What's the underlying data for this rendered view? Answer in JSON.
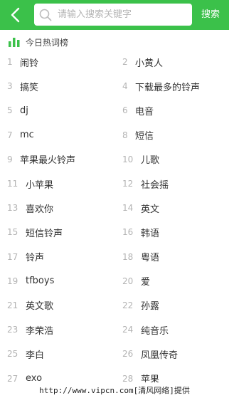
{
  "colors": {
    "accent": "#3bc14a",
    "rank_number": "#b3b3b3"
  },
  "header": {
    "back_icon": "chevron-left-icon",
    "search_placeholder": "请输入搜索关键字",
    "search_button": "搜索"
  },
  "hot": {
    "title": "今日热词榜",
    "icon": "bar-chart-icon",
    "items": [
      {
        "rank": "1",
        "keyword": "闹铃"
      },
      {
        "rank": "2",
        "keyword": "小黄人"
      },
      {
        "rank": "3",
        "keyword": "搞笑"
      },
      {
        "rank": "4",
        "keyword": "下载最多的铃声"
      },
      {
        "rank": "5",
        "keyword": "dj"
      },
      {
        "rank": "6",
        "keyword": "电音"
      },
      {
        "rank": "7",
        "keyword": "mc"
      },
      {
        "rank": "8",
        "keyword": "短信"
      },
      {
        "rank": "9",
        "keyword": "苹果最火铃声"
      },
      {
        "rank": "10",
        "keyword": "儿歌"
      },
      {
        "rank": "11",
        "keyword": "小苹果"
      },
      {
        "rank": "12",
        "keyword": "社会摇"
      },
      {
        "rank": "13",
        "keyword": "喜欢你"
      },
      {
        "rank": "14",
        "keyword": "英文"
      },
      {
        "rank": "15",
        "keyword": "短信铃声"
      },
      {
        "rank": "16",
        "keyword": "韩语"
      },
      {
        "rank": "17",
        "keyword": "铃声"
      },
      {
        "rank": "18",
        "keyword": "粤语"
      },
      {
        "rank": "19",
        "keyword": "tfboys"
      },
      {
        "rank": "20",
        "keyword": "爱"
      },
      {
        "rank": "21",
        "keyword": "英文歌"
      },
      {
        "rank": "22",
        "keyword": "孙露"
      },
      {
        "rank": "23",
        "keyword": "李荣浩"
      },
      {
        "rank": "24",
        "keyword": "纯音乐"
      },
      {
        "rank": "25",
        "keyword": "李白"
      },
      {
        "rank": "26",
        "keyword": "凤凰传奇"
      },
      {
        "rank": "27",
        "keyword": "exo"
      },
      {
        "rank": "28",
        "keyword": "苹果"
      }
    ]
  },
  "watermark": "http://www.vipcn.com[清风网络]提供"
}
